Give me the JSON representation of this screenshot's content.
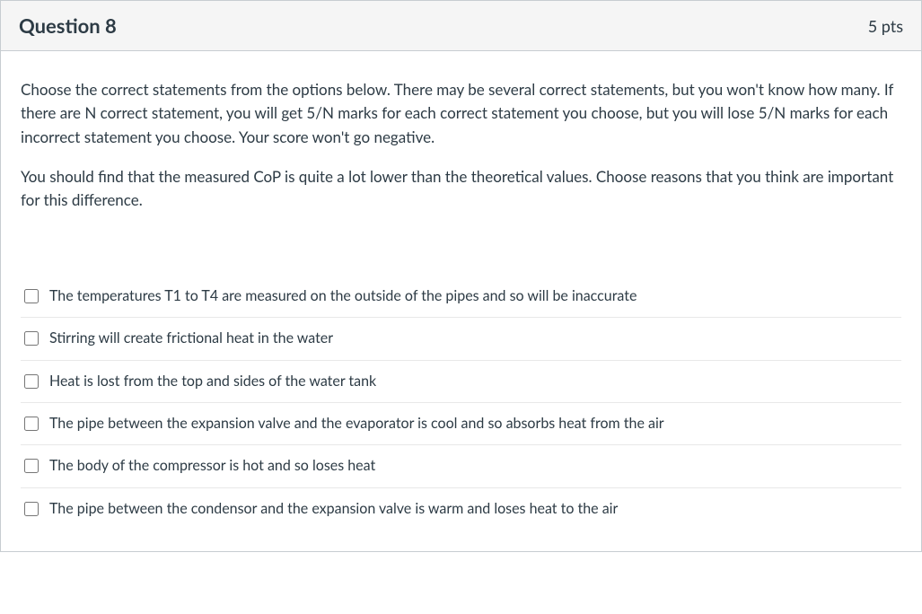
{
  "header": {
    "title": "Question 8",
    "points": "5 pts"
  },
  "prompt": {
    "paragraph1": "Choose the correct statements from the options below. There may be several correct statements, but you won't know how many. If there are N correct statement, you will get 5/N marks for each correct statement you choose, but you will lose 5/N marks for each incorrect statement you choose. Your score won't go negative.",
    "paragraph2": "You should find that the measured CoP is quite a lot lower than the theoretical values. Choose reasons that you think are important for this difference."
  },
  "options": [
    {
      "label": "The temperatures T1 to T4 are measured on the outside of the pipes and so will be inaccurate"
    },
    {
      "label": "Stirring will create frictional heat in the water"
    },
    {
      "label": "Heat is lost from the top and sides of the water tank"
    },
    {
      "label": "The pipe between the expansion valve and the evaporator is cool and so absorbs heat from the air"
    },
    {
      "label": "The body of the compressor is hot and so loses heat"
    },
    {
      "label": "The pipe between the condensor and the expansion valve is warm and loses heat to the air"
    }
  ]
}
